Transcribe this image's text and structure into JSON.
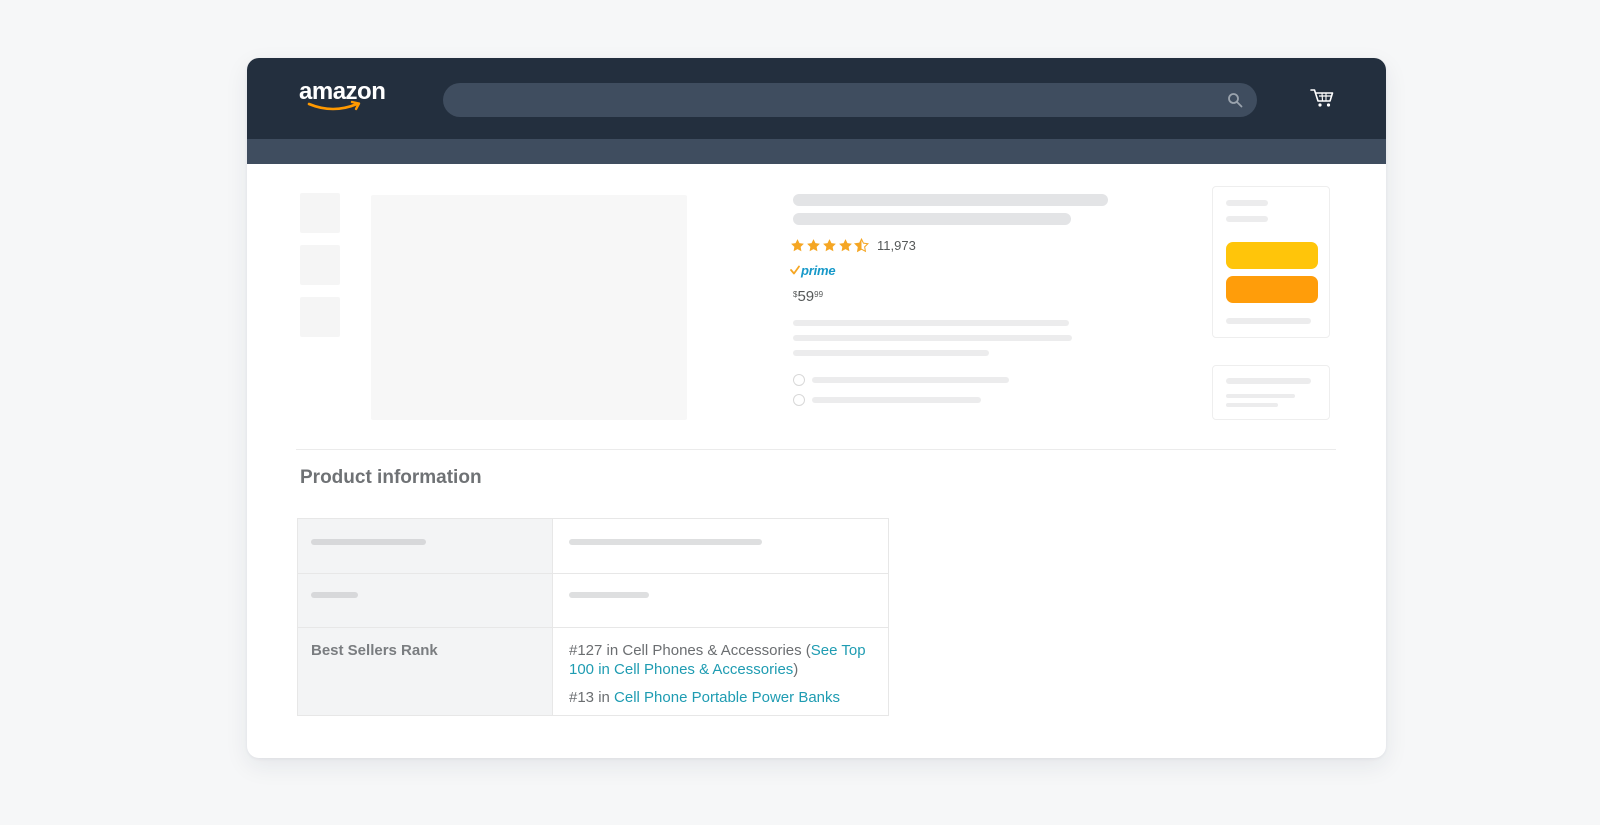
{
  "header": {
    "logo_text": "amazon",
    "search_placeholder": "",
    "brand_color": "#232f3e",
    "accent_color": "#ff9900"
  },
  "icons": {
    "search": "search-icon",
    "cart": "cart-icon",
    "star": "star-icon",
    "prime_check": "checkmark-icon"
  },
  "product": {
    "rating": 4.5,
    "rating_count": "11,973",
    "prime_label": "prime",
    "price": {
      "symbol": "$",
      "whole": "59",
      "fraction": "99"
    },
    "star_color": "#f5a623"
  },
  "buybox": {
    "add_to_cart_color": "#ffc50a",
    "buy_now_color": "#ff9d0a"
  },
  "product_information": {
    "title": "Product information",
    "best_sellers_rank": {
      "label": "Best Sellers Rank",
      "line1_prefix": "#127 in Cell Phones & Accessories (",
      "line1_link": "See Top 100 in Cell Phones & Accessories",
      "line1_suffix": ")",
      "line2_prefix": "#13 in ",
      "line2_link": "Cell Phone Portable Power Banks",
      "link_color": "#1f9cb2"
    }
  }
}
